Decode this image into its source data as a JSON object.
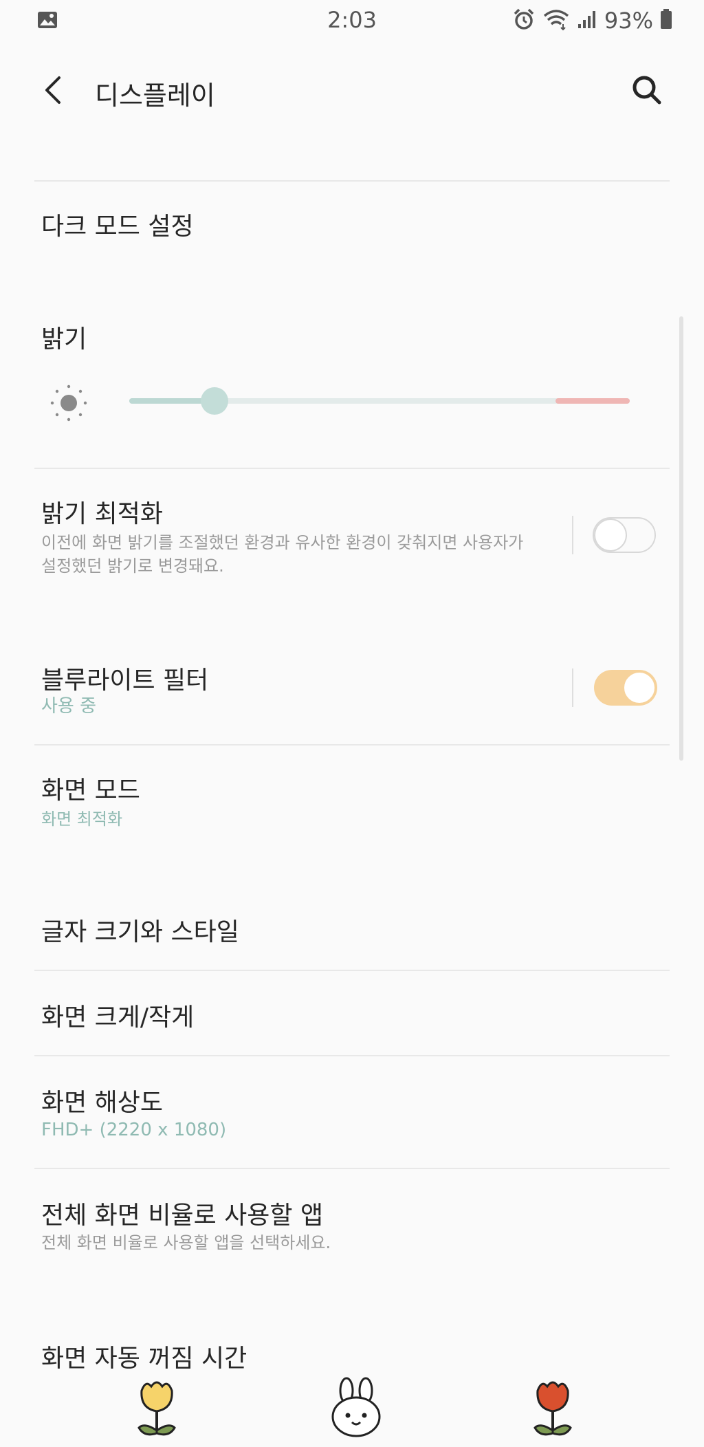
{
  "status_bar": {
    "time": "2:03",
    "battery_percent": "93%",
    "icons": [
      "gallery-notification-icon",
      "alarm-icon",
      "wifi-icon",
      "signal-icon",
      "battery-icon"
    ]
  },
  "app_bar": {
    "title": "디스플레이",
    "back_icon": "back-arrow-icon",
    "search_icon": "search-icon"
  },
  "settings": {
    "dark_mode": {
      "title": "다크 모드 설정"
    },
    "brightness": {
      "title": "밝기",
      "level": 0.17
    },
    "adaptive_brightness": {
      "title": "밝기 최적화",
      "desc_line1": "이전에 화면 밝기를 조절했던 환경과 유사한 환경이 갖춰지면 사용자가",
      "desc_line2": "설정했던 밝기로 변경돼요.",
      "enabled": false
    },
    "blue_light": {
      "title": "블루라이트 필터",
      "subtitle": "사용 중",
      "enabled": true
    },
    "screen_mode": {
      "title": "화면 모드",
      "subtitle": "화면 최적화"
    },
    "font_size": {
      "title": "글자 크기와 스타일"
    },
    "screen_zoom": {
      "title": "화면 크게/작게"
    },
    "resolution": {
      "title": "화면 해상도",
      "subtitle": "FHD+ (2220 x 1080)"
    },
    "full_screen_apps": {
      "title": "전체 화면 비율로 사용할 앱",
      "subtitle": "전체 화면 비율로 사용할 앱을 선택하세요."
    },
    "screen_timeout": {
      "title": "화면 자동 꺼짐 시간"
    }
  },
  "colors": {
    "accent_teal": "#8fbab2",
    "toggle_on": "#f6d29b",
    "slider_fill": "#bcd8d3",
    "slider_warning": "#efb6b4"
  },
  "bottom_icons": [
    "yellow-flower-icon",
    "bunny-face-icon",
    "red-flower-icon"
  ]
}
